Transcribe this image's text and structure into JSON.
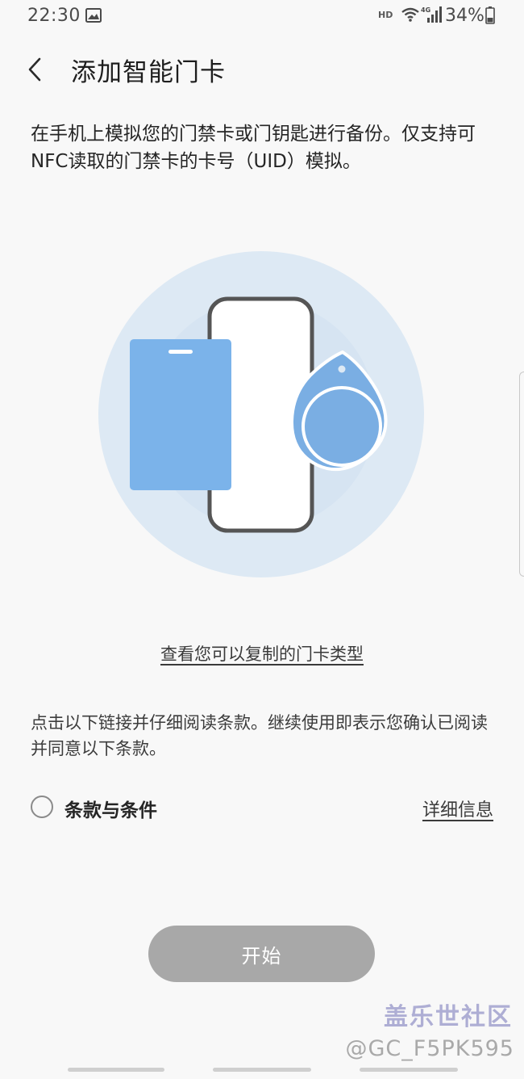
{
  "status_bar": {
    "time": "22:30",
    "hd_label": "HD",
    "network_label": "4G",
    "battery": "34%"
  },
  "header": {
    "title": "添加智能门卡"
  },
  "description": "在手机上模拟您的门禁卡或门钥匙进行备份。仅支持可NFC读取的门禁卡的卡号（UID）模拟。",
  "card_types_link": "查看您可以复制的门卡类型",
  "terms_notice": "点击以下链接并仔细阅读条款。继续使用即表示您确认已阅读并同意以下条款。",
  "terms": {
    "label": "条款与条件",
    "details_link": "详细信息",
    "checked": false
  },
  "start_button": "开始",
  "watermark": {
    "line1": "盖乐世社区",
    "line2": "@GC_F5PK595"
  },
  "colors": {
    "background": "#f8f8f8",
    "illustration_circle": "#dde9f4",
    "card_blue": "#7bb3ea",
    "fob_blue": "#7aaee3",
    "button_disabled": "#a8a8a8"
  }
}
